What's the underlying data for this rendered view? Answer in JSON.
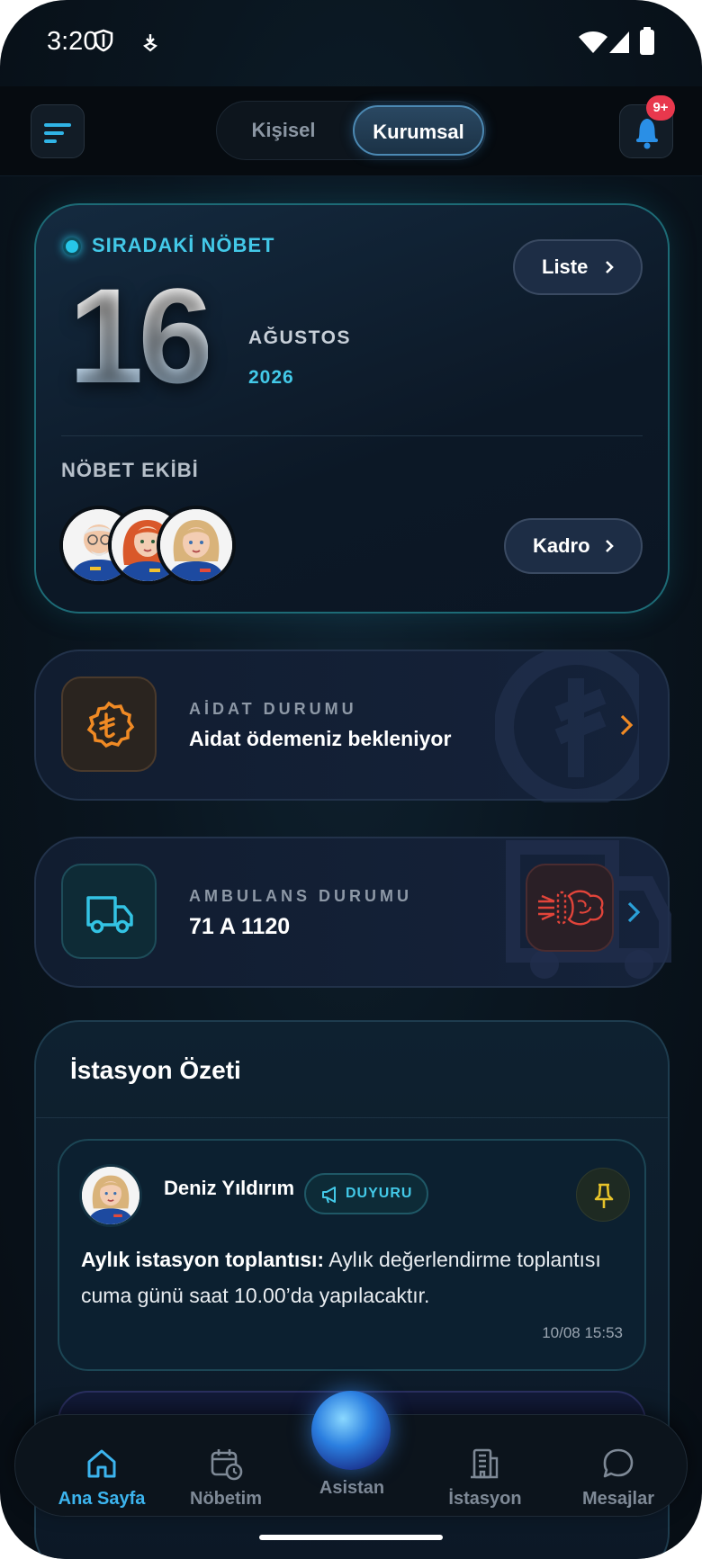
{
  "status_bar": {
    "time": "3:20"
  },
  "header": {
    "segments": [
      {
        "label": "Kişisel"
      },
      {
        "label": "Kurumsal"
      }
    ],
    "notification_badge": "9+"
  },
  "next_shift": {
    "label": "SIRADAKİ NÖBET",
    "list_button": "Liste",
    "day": "16",
    "month": "AĞUSTOS",
    "year": "2026",
    "team_label": "NÖBET EKİBİ",
    "roster_button": "Kadro"
  },
  "dues": {
    "kicker": "AİDAT DURUMU",
    "title": "Aidat ödemeniz bekleniyor"
  },
  "ambulance": {
    "kicker": "AMBULANS DURUMU",
    "title": "71 A 1120"
  },
  "station_summary": {
    "title": "İstasyon Özeti",
    "post": {
      "author": "Deniz Yıldırım",
      "tag": "DUYURU",
      "headline": "Aylık istasyon toplantısı:",
      "body": " Aylık değerlendirme toplantısı cuma günü saat 10.00’da yapılacaktır.",
      "time": "10/08 15:53"
    }
  },
  "nav": [
    {
      "label": "Ana Sayfa",
      "icon": "home-icon",
      "active": true
    },
    {
      "label": "Nöbetim",
      "icon": "calendar-clock-icon"
    },
    {
      "label": "Asistan",
      "icon": "assistant-orb-icon"
    },
    {
      "label": "İstasyon",
      "icon": "building-icon"
    },
    {
      "label": "Mesajlar",
      "icon": "chat-bubble-icon"
    }
  ],
  "colors": {
    "accent": "#43c9e8",
    "active_nav": "#3cb4ee",
    "badge": "#e8384d",
    "warning": "#f08a24",
    "alert": "#e2443a"
  }
}
